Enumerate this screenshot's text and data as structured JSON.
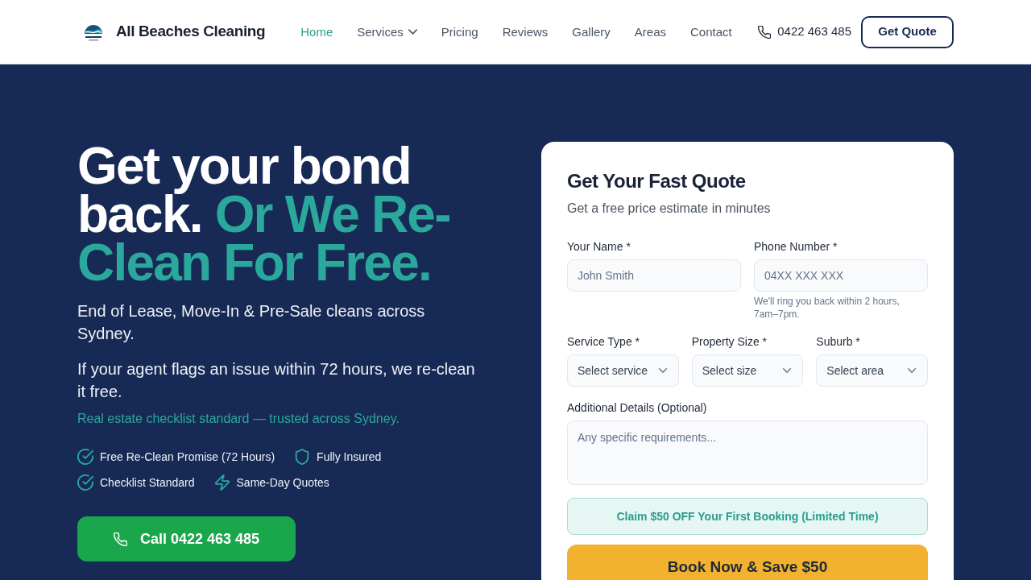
{
  "brand": {
    "name": "All Beaches Cleaning"
  },
  "nav": {
    "items": [
      {
        "label": "Home",
        "selected": true,
        "kind": "link"
      },
      {
        "label": "Services",
        "selected": false,
        "kind": "dropdown"
      },
      {
        "label": "Pricing",
        "selected": false,
        "kind": "link"
      },
      {
        "label": "Reviews",
        "selected": false,
        "kind": "link"
      },
      {
        "label": "Gallery",
        "selected": false,
        "kind": "link"
      },
      {
        "label": "Areas",
        "selected": false,
        "kind": "link"
      },
      {
        "label": "Contact",
        "selected": false,
        "kind": "link"
      }
    ]
  },
  "header_actions": {
    "phone": "0422 463 485",
    "quote_button": "Get Quote"
  },
  "hero": {
    "headline": {
      "lead": "Get your bond back.",
      "accent": "Or We Re-Clean For Free."
    },
    "paragraphs": [
      "End of Lease, Move-In & Pre-Sale cleans across Sydney.",
      "If your agent flags an issue within 72 hours, we re-clean it free."
    ],
    "tagline": "Real estate checklist standard — trusted across Sydney.",
    "features": [
      {
        "kind": "check",
        "label": "Free Re-Clean Promise (72 Hours)"
      },
      {
        "kind": "shield",
        "label": "Fully Insured"
      },
      {
        "kind": "check",
        "label": "Checklist Standard"
      },
      {
        "kind": "bolt",
        "label": "Same-Day Quotes"
      }
    ],
    "call_button": "Call 0422 463 485"
  },
  "quote_form": {
    "title": "Get Your Fast Quote",
    "subtitle": "Get a free price estimate in minutes",
    "rows": [
      [
        {
          "kind": "text",
          "label": "Your Name *",
          "placeholder": "John Smith"
        },
        {
          "kind": "text",
          "label": "Phone Number *",
          "placeholder": "04XX XXX XXX",
          "help": "We'll ring you back within 2 hours, 7am–7pm."
        }
      ],
      [
        {
          "kind": "select",
          "label": "Service Type *",
          "placeholder": "Select service"
        },
        {
          "kind": "select",
          "label": "Property Size *",
          "placeholder": "Select size"
        },
        {
          "kind": "select",
          "label": "Suburb *",
          "placeholder": "Select area"
        }
      ],
      [
        {
          "kind": "textarea",
          "label": "Additional Details (Optional)",
          "placeholder": "Any specific requirements..."
        }
      ]
    ],
    "promo": "Claim $50 OFF Your First Booking (Limited Time)",
    "submit_button": "Book Now & Save $50"
  }
}
